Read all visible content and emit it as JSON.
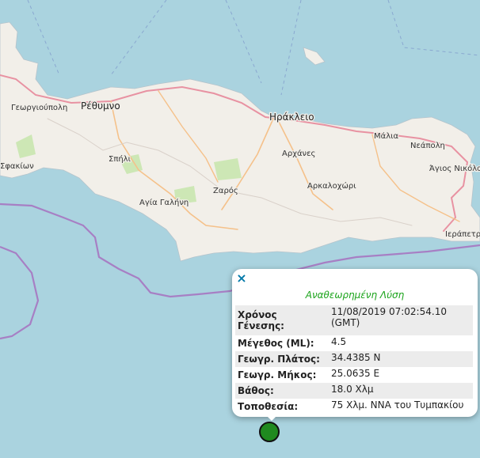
{
  "map": {
    "places": [
      "Γεωργιούπολη",
      "Ρέθυμνο",
      "Σφακίων",
      "Σπήλι",
      "Αγία Γαλήνη",
      "Ζαρός",
      "Ηράκλειο",
      "Αρχάνες",
      "Αρκαλοχώρι",
      "Μάλια",
      "Νεάπολη",
      "Άγιος Νικόλαος",
      "Ιεράπετρα"
    ],
    "colors": {
      "sea": "#aad3df",
      "land": "#f2efe9",
      "boundary": "#a77fc4",
      "road": "#e892a2",
      "secondary_road": "#f5c18a"
    }
  },
  "popup": {
    "close_label": "×",
    "title": "Αναθεωρημένη Λύση",
    "rows": [
      {
        "key": "Χρόνος Γένεσης:",
        "value": "11/08/2019 07:02:54.10 (GMT)"
      },
      {
        "key": "Μέγεθος (ML):",
        "value": "4.5"
      },
      {
        "key": "Γεωγρ. Πλάτος:",
        "value": "34.4385 N"
      },
      {
        "key": "Γεωγρ. Μήκος:",
        "value": "25.0635 E"
      },
      {
        "key": "Βάθος:",
        "value": "18.0 Χλμ"
      },
      {
        "key": "Τοποθεσία:",
        "value": "75 Χλμ. ΝΝΑ του Τυμπακίου"
      }
    ]
  },
  "marker": {
    "color": "#1f8a1f",
    "icon": "earthquake-marker-icon"
  }
}
